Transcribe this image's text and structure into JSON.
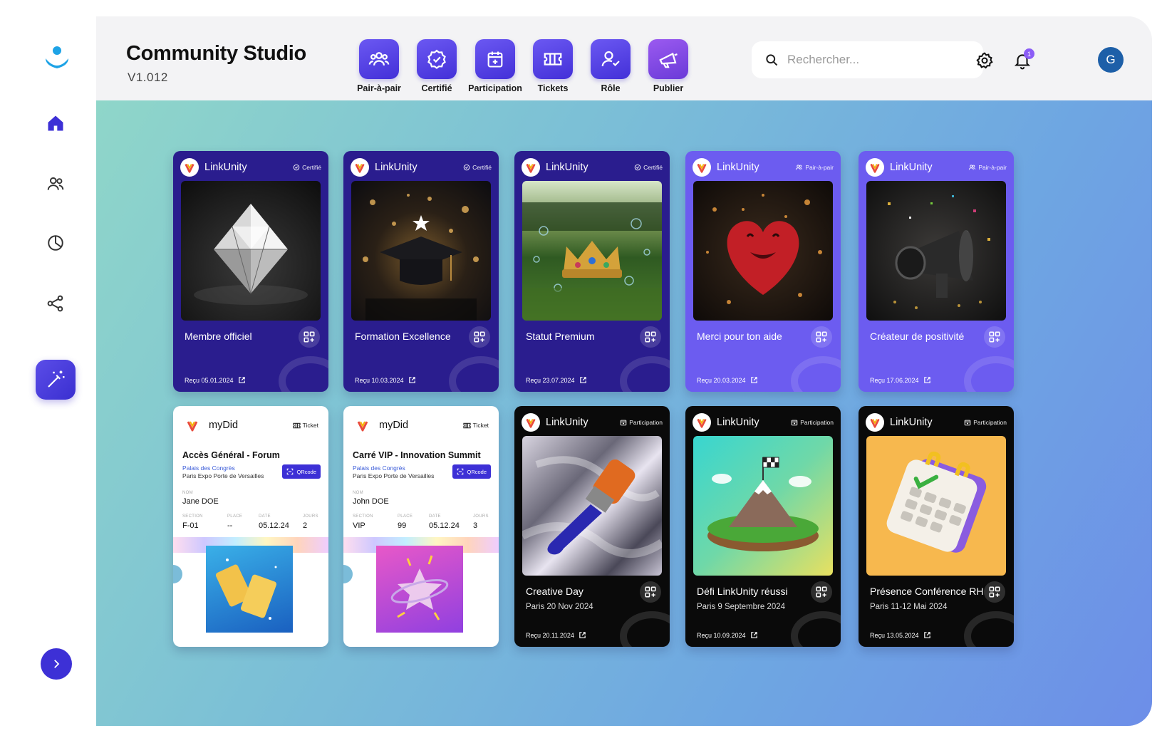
{
  "app": {
    "title": "Community Studio",
    "version": "V1.012"
  },
  "toolbar": [
    {
      "label": "Pair-à-pair",
      "icon": "users-icon"
    },
    {
      "label": "Certifié",
      "icon": "badge-check-icon"
    },
    {
      "label": "Participation",
      "icon": "calendar-plus-icon"
    },
    {
      "label": "Tickets",
      "icon": "ticket-icon"
    },
    {
      "label": "Rôle",
      "icon": "user-check-icon"
    },
    {
      "label": "Publier",
      "icon": "megaphone-icon"
    }
  ],
  "search": {
    "placeholder": "Rechercher..."
  },
  "notifications": {
    "count": "1"
  },
  "user": {
    "initial": "G"
  },
  "cards": [
    {
      "brand": "LinkUnity",
      "tag": "Certifié",
      "title": "Membre officiel",
      "date": "Reçu 05.01.2024"
    },
    {
      "brand": "LinkUnity",
      "tag": "Certifié",
      "title": "Formation Excellence",
      "date": "Reçu 10.03.2024"
    },
    {
      "brand": "LinkUnity",
      "tag": "Certifié",
      "title": "Statut Premium",
      "date": "Reçu 23.07.2024"
    },
    {
      "brand": "LinkUnity",
      "tag": "Pair-à-pair",
      "title": "Merci pour ton aide",
      "date": "Reçu 20.03.2024"
    },
    {
      "brand": "LinkUnity",
      "tag": "Pair-à-pair",
      "title": "Créateur de positivité",
      "date": "Reçu 17.06.2024"
    },
    {
      "brand": "LinkUnity",
      "tag": "Participation",
      "title": "Creative Day",
      "subtitle": "Paris 20 Nov 2024",
      "date": "Reçu 20.11.2024"
    },
    {
      "brand": "LinkUnity",
      "tag": "Participation",
      "title": "Défi LinkUnity réussi",
      "subtitle": "Paris 9 Septembre 2024",
      "date": "Reçu 10.09.2024"
    },
    {
      "brand": "LinkUnity",
      "tag": "Participation",
      "title": "Présence Conférence RH",
      "subtitle": "Paris 11-12 Mai 2024",
      "date": "Reçu 13.05.2024"
    }
  ],
  "tickets": [
    {
      "brand": "myDid",
      "tag": "Ticket",
      "title": "Accès Général - Forum",
      "place_line1": "Palais des Congrès",
      "place_line2": "Paris Expo Porte de Versailles",
      "qr_label": "QRcode",
      "labels": {
        "name": "NOM",
        "section": "SECTION",
        "place": "PLACE",
        "date": "DATE",
        "days": "JOURS"
      },
      "name": "Jane DOE",
      "section": "F-01",
      "place": "--",
      "date": "05.12.24",
      "days": "2"
    },
    {
      "brand": "myDid",
      "tag": "Ticket",
      "title": "Carré VIP - Innovation Summit",
      "place_line1": "Palais des Congrès",
      "place_line2": "Paris Expo Porte de Versailles",
      "qr_label": "QRcode",
      "labels": {
        "name": "NOM",
        "section": "SECTION",
        "place": "PLACE",
        "date": "DATE",
        "days": "JOURS"
      },
      "name": "John DOE",
      "section": "VIP",
      "place": "99",
      "date": "05.12.24",
      "days": "3"
    }
  ],
  "colors": {
    "accent": "#3d30d6",
    "navy_card": "#2a1d8e",
    "violet_card": "#6c5cf0",
    "black_card": "#0a0a0a"
  }
}
